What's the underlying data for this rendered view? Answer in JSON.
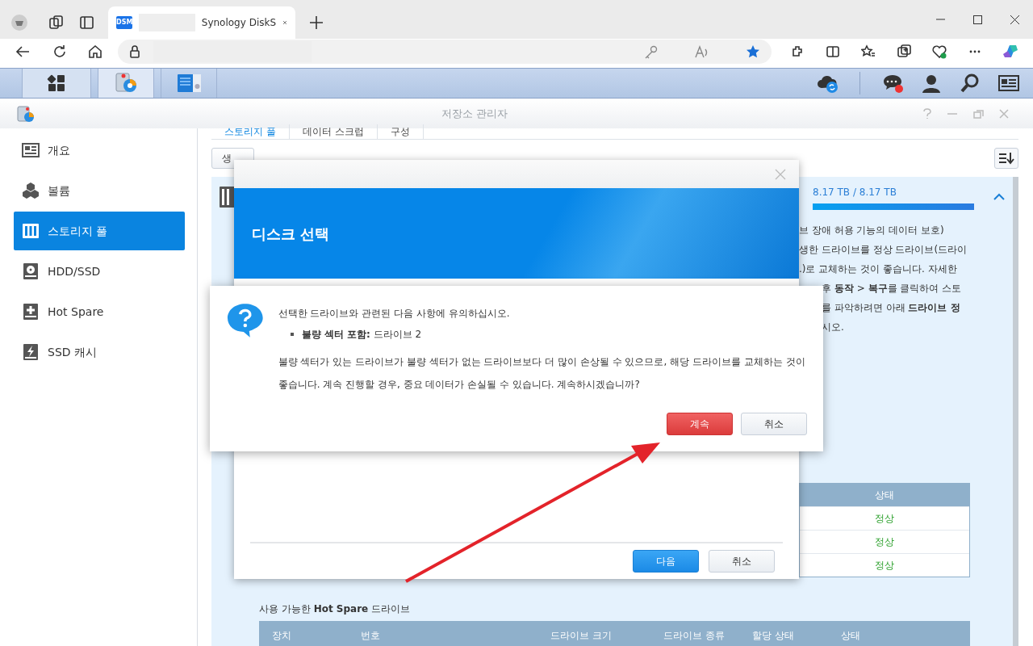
{
  "browser": {
    "tab": {
      "favicon": "DSM",
      "title": "Synology DiskS",
      "selected": true
    }
  },
  "taskbar": {
    "apps": [
      {
        "kind": "menu",
        "selected": false
      },
      {
        "kind": "storage",
        "selected": true
      },
      {
        "kind": "info",
        "selected": false
      }
    ]
  },
  "app": {
    "title": "저장소 관리자"
  },
  "sidebar": {
    "items": [
      {
        "label": "개요",
        "kind": "overview",
        "selected": false
      },
      {
        "label": "볼륨",
        "kind": "volume",
        "selected": false
      },
      {
        "label": "스토리지 풀",
        "kind": "pool",
        "selected": true
      },
      {
        "label": "HDD/SSD",
        "kind": "disk",
        "selected": false
      },
      {
        "label": "Hot Spare",
        "kind": "spare",
        "selected": false
      },
      {
        "label": "SSD 캐시",
        "kind": "cache",
        "selected": false
      }
    ]
  },
  "tabs": [
    {
      "label": "스토리지 풀",
      "selected": true
    },
    {
      "label": "데이터 스크럽",
      "selected": false
    },
    {
      "label": "구성",
      "selected": false
    }
  ],
  "toolbar": {
    "buttons": [
      "생"
    ]
  },
  "pool": {
    "usage": "8.17 TB / 8.17 TB",
    "level": 1.0,
    "description_lines": [
      "브 장애 허용 기능의 데이터 보호)",
      "생한 드라이브를 정상 드라이브(드라이",
      ".)로 교체하는 것이 좋습니다. 자세한",
      "후 **동작** > **복구**를 클릭하여 스토",
      "를 파악하려면 아래 **드라이브 정**",
      "시오."
    ],
    "table": {
      "columns": [
        "상태"
      ],
      "rows": [
        {
          "status": "정상"
        },
        {
          "status": "정상"
        },
        {
          "status": "정상"
        }
      ]
    }
  },
  "hot_spare": {
    "title": "사용 가능한 **Hot Spare** 드라이브",
    "columns": [
      "장치",
      "번호",
      "드라이브 크기",
      "드라이브 종류",
      "할당 상태",
      "상태"
    ]
  },
  "wizard": {
    "title": "디스크 선택",
    "buttons": [
      {
        "label": "다음",
        "kind": "primary"
      },
      {
        "label": "취소",
        "kind": "default"
      }
    ]
  },
  "alert": {
    "message": "선택한 드라이브와 관련된 다음 사항에 유의하십시오.",
    "items": [
      "**불량 섹터 포함:** 드라이브 2"
    ],
    "detail": "불량 섹터가 있는 드라이브가 불량 섹터가 없는 드라이브보다 더 많이 손상될 수 있으므로, 해당 드라이브를 교체하는 것이 좋습니다. 계속 진행할 경우, 중요 데이터가 손실될 수 있습니다. 계속하시겠습니까?",
    "buttons": [
      {
        "label": "계속",
        "kind": "danger"
      },
      {
        "label": "취소",
        "kind": "default"
      }
    ]
  }
}
